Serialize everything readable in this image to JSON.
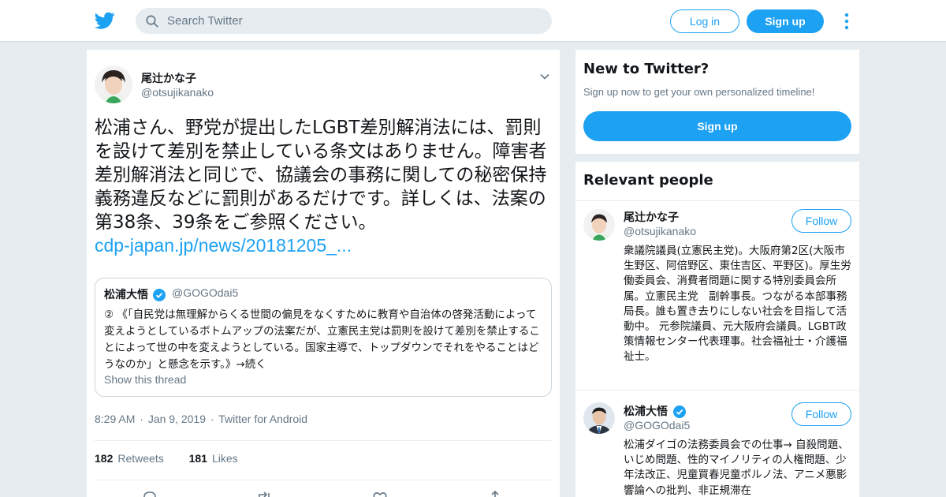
{
  "brand": {
    "accent": "#1da1f2",
    "background": "#e6ecf0"
  },
  "header": {
    "logo_icon": "twitter-bird-icon",
    "search_placeholder": "Search Twitter",
    "login_label": "Log in",
    "signup_label": "Sign up",
    "more_icon": "vertical-dots-icon"
  },
  "tweet": {
    "author_name": "尾辻かな子",
    "author_handle": "@otsujikanako",
    "text": "松浦さん、野党が提出したLGBT差別解消法には、罰則を設けて差別を禁止している条文はありません。障害者差別解消法と同じで、協議会の事務に関しての秘密保持義務違反などに罰則があるだけです。詳しくは、法案の第38条、39条をご参照ください。",
    "link": "cdp-japan.jp/news/20181205_...",
    "quote": {
      "author_name": "松浦大悟",
      "author_handle": "@GOGOdai5",
      "text": "② 《「自民党は無理解からくる世間の偏見をなくすために教育や自治体の啓発活動によって変えようとしているボトムアップの法案だが、立憲民主党は罰則を設けて差別を禁止することによって世の中を変えようとしている。国家主導で、トップダウンでそれをやることはどうなのか」と懸念を示す。》→続く",
      "show_thread": "Show this thread"
    },
    "time": "8:29 AM",
    "date": "Jan 9, 2019",
    "source": "Twitter for Android",
    "sep": "·",
    "retweets_count": "182",
    "retweets_label": "Retweets",
    "likes_count": "181",
    "likes_label": "Likes"
  },
  "sidebar": {
    "new_title": "New to Twitter?",
    "new_sub": "Sign up now to get your own personalized timeline!",
    "new_signup": "Sign up",
    "relevant_title": "Relevant people",
    "people": [
      {
        "name": "尾辻かな子",
        "handle": "@otsujikanako",
        "follow": "Follow",
        "bio": "衆議院議員(立憲民主党)。大阪府第2区(大阪市 生野区、阿倍野区、東住吉区、平野区)。厚生労働委員会、消費者問題に関する特別委員会所属。立憲民主党　副幹事長。つながる本部事務局長。誰も置き去りにしない社会を目指して活動中。 元参院議員、元大阪府会議員。LGBT政策情報センター代表理事。社会福祉士・介護福祉士。"
      },
      {
        "name": "松浦大悟",
        "handle": "@GOGOdai5",
        "follow": "Follow",
        "bio": "松浦ダイゴの法務委員会での仕事→ 自殺問題、いじめ問題、性的マイノリティの人権問題、少年法改正、児童買春児童ポルノ法、アニメ悪影響論への批判、非正規滞在"
      }
    ]
  }
}
